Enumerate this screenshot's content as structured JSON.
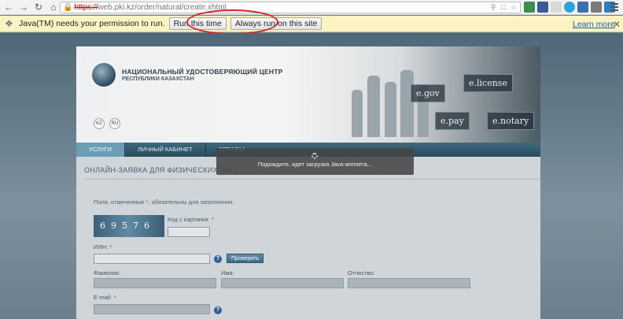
{
  "browser": {
    "url_scheme": "https://",
    "url_rest": "web.pki.kz/order/natural/create.xhtml",
    "nav_icons": [
      "back-icon",
      "forward-icon",
      "reload-icon",
      "home-icon"
    ]
  },
  "infobar": {
    "message": "Java(TM) needs your permission to run.",
    "run_once_label": "Run this time",
    "always_run_label": "Always run on this site",
    "learn_more_label": "Learn more"
  },
  "site": {
    "org_name": "НАЦИОНАЛЬНЫЙ УДОСТОВЕРЯЮЩИЙ ЦЕНТР",
    "org_sub": "РЕСПУБЛИКИ КАЗАХСТАН",
    "lang_kz": "KZ",
    "lang_ru": "RU",
    "banner_tiles": [
      "e.gov",
      "e.license",
      "e.pay",
      "e.notary"
    ],
    "nav": [
      {
        "label": "УСЛУГИ"
      },
      {
        "label": "ЛИЧНЫЙ КАБИНЕТ"
      },
      {
        "label": "СПРАВКА"
      }
    ],
    "section_title": "ОНЛАЙН-ЗАЯВКА ДЛЯ ФИЗИЧЕСКИХ ЛИЦ",
    "required_note_prefix": "Поля, отмеченные ",
    "required_note_star": "*",
    "required_note_suffix": ", обязательны для заполнения.",
    "captcha_text": "69576",
    "captcha_label": "Код с картинки:",
    "iin_label": "ИИН:",
    "check_button": "Проверить",
    "surname_label": "Фамилия:",
    "name_label": "Имя:",
    "patronymic_label": "Отчество:",
    "email_label": "E-mail:",
    "required_star": "*"
  },
  "overlay": {
    "message": "Подождите, идет загрузка Java-апплета..."
  },
  "annotation": {
    "highlight_color": "#d2232a"
  }
}
